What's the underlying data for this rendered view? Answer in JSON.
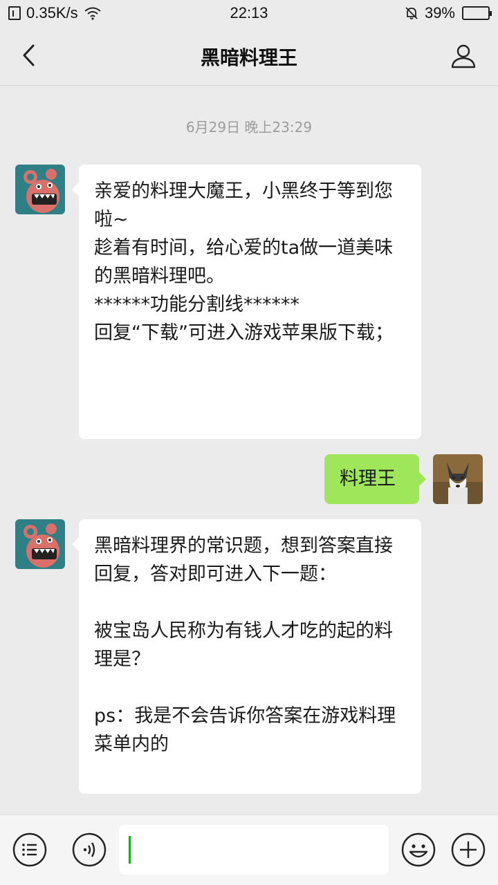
{
  "status_bar": {
    "net_speed": "0.35K/s",
    "time": "22:13",
    "battery_percent": "39%",
    "battery_level": 0.39,
    "icons": [
      "network-icon",
      "wifi-icon",
      "bell-off-icon",
      "battery-icon"
    ]
  },
  "nav": {
    "title": "黑暗料理王",
    "back_icon": "chevron-left-icon",
    "profile_icon": "user-profile-icon"
  },
  "chat": {
    "timestamp": "6月29日 晚上23:29",
    "messages": [
      {
        "direction": "in",
        "sender": "黑暗料理王",
        "text": "亲爱的料理大魔王，小黑终于等到您啦~\n趁着有时间，给心爱的ta做一道美味的黑暗料理吧。\n******功能分割线******\n回复“下载”可进入游戏苹果版下载；\n\n"
      },
      {
        "direction": "out",
        "sender": "me",
        "text": "料理王"
      },
      {
        "direction": "in",
        "sender": "黑暗料理王",
        "text": "黑暗料理界的常识题，想到答案直接回复，答对即可进入下一题：\n\n被宝岛人民称为有钱人才吃的起的料理是？\n\nps：我是不会告诉你答案在游戏料理菜单内的"
      }
    ]
  },
  "input_bar": {
    "menu_icon": "menu-list-icon",
    "voice_icon": "voice-icon",
    "emoji_icon": "emoji-icon",
    "plus_icon": "plus-icon",
    "value": ""
  },
  "colors": {
    "background": "#ebebeb",
    "bubble_in": "#ffffff",
    "bubble_out": "#9fe65a",
    "cursor": "#1aad19"
  }
}
